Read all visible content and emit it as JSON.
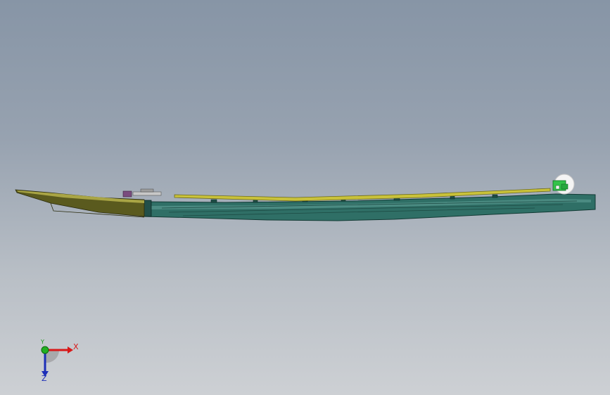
{
  "viewport": {
    "background_top": "#8795a6",
    "background_bottom": "#cdd0d4"
  },
  "model": {
    "body_color": "#2f6f66",
    "deck_color": "#c9c23a",
    "bow_color": "#5a5a1e",
    "accent_color": "#33c24a"
  },
  "triad": {
    "x_label": "X",
    "y_label": "Y",
    "z_label": "Z",
    "x_color": "#d81818",
    "y_color": "#1a9a1a",
    "z_color": "#1d2fb8"
  }
}
